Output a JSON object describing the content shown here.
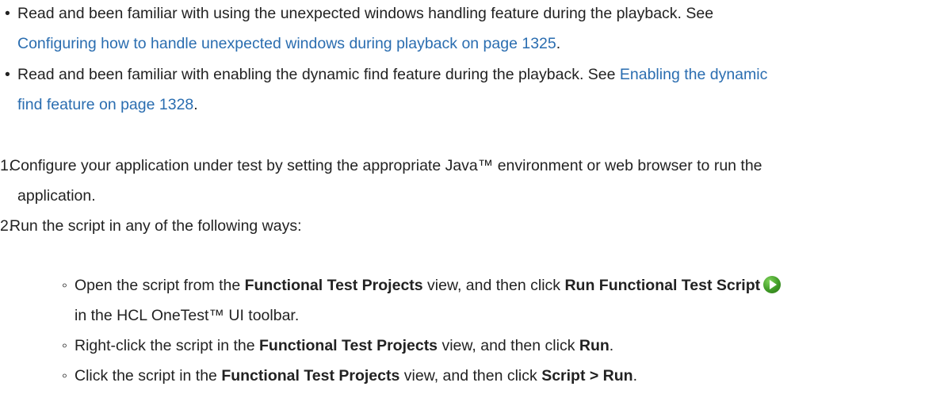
{
  "prereqs": [
    {
      "bullet": "•",
      "line1": "Read and been familiar with using the unexpected windows handling feature during the playback. See",
      "link_part1": "",
      "link_part2": "Configuring how to handle unexpected windows during playback on page 1325",
      "end": "."
    },
    {
      "bullet": "•",
      "text": "Read and been familiar with enabling the dynamic find feature during the playback. See ",
      "link_part1": "Enabling the dynamic",
      "link_part2": "find feature on page 1328",
      "end": "."
    }
  ],
  "steps": [
    {
      "num": "1.",
      "line1": "Configure your application under test by setting the appropriate Java™ environment or web browser to run the",
      "line2": "application."
    },
    {
      "num": "2.",
      "line1": "Run the script in any of the following ways:"
    }
  ],
  "substeps": [
    {
      "bullet": "◦",
      "a": "Open the script from the ",
      "b1": "Functional Test Projects",
      "c": " view, and then click ",
      "b2": "Run Functional Test Script",
      "line2": "in the HCL OneTest™ UI toolbar."
    },
    {
      "bullet": "◦",
      "a": "Right-click the script in the ",
      "b1": "Functional Test Projects",
      "c": " view, and then click ",
      "b2": "Run",
      "end": "."
    },
    {
      "bullet": "◦",
      "a": "Click the script in the ",
      "b1": "Functional Test Projects",
      "c": " view, and then click ",
      "b2": "Script > Run",
      "end": "."
    }
  ],
  "icons": {
    "run": "run-functional-test-script-icon"
  }
}
